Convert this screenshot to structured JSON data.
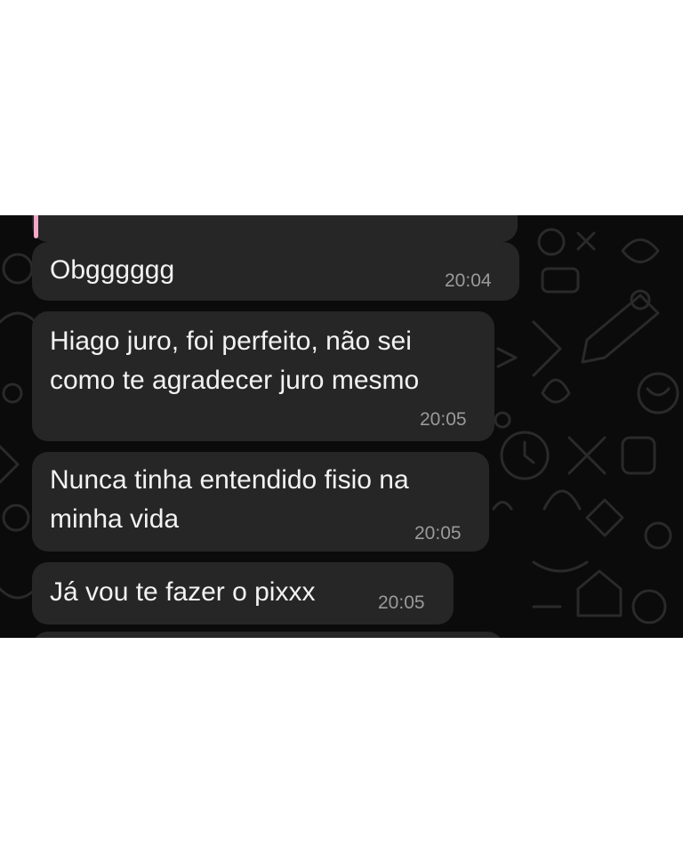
{
  "chat": {
    "background_color": "#0b0b0b",
    "bubble_color": "#262626",
    "text_color": "#f2f2f2",
    "time_color": "#9a9a9a",
    "quote_accent_color": "#f4a7c8",
    "messages": [
      {
        "text_lines": [
          "Obgggggg"
        ],
        "time": "20:04"
      },
      {
        "text_lines": [
          "Hiago juro, foi perfeito, não sei",
          "como te agradecer juro mesmo"
        ],
        "time": "20:05"
      },
      {
        "text_lines": [
          "Nunca tinha entendido fisio na",
          "minha vida"
        ],
        "time": "20:05"
      },
      {
        "text_lines": [
          "Já vou te fazer o pixxx"
        ],
        "time": "20:05"
      }
    ]
  }
}
